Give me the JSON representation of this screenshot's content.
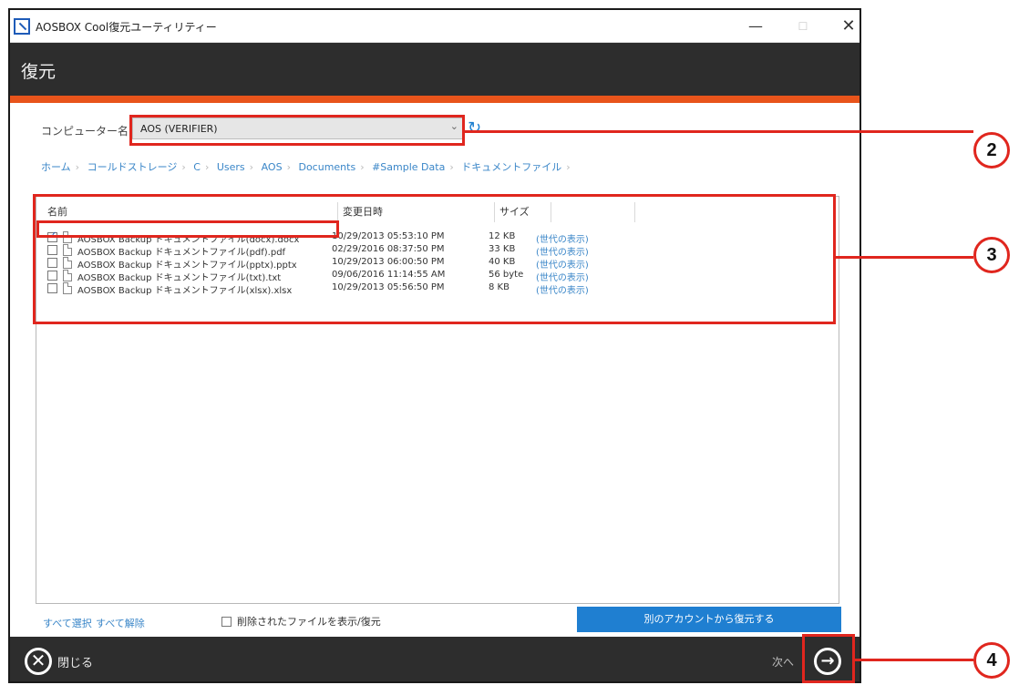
{
  "window": {
    "title": "AOSBOX Cool復元ユーティリティー",
    "minimize": "—",
    "maximize": "☐",
    "close": "✕"
  },
  "header": {
    "title": "復元"
  },
  "computer": {
    "label": "コンピューター名",
    "value": "AOS (VERIFIER)"
  },
  "breadcrumb": [
    "ホーム",
    "コールドストレージ",
    "C",
    "Users",
    "AOS",
    "Documents",
    "#Sample Data",
    "ドキュメントファイル"
  ],
  "breadcrumb_sep": "›",
  "table": {
    "columns": {
      "name": "名前",
      "date": "変更日時",
      "size": "サイズ"
    },
    "rows": [
      {
        "name": "AOSBOX Backup ドキュメントファイル(docx).docx",
        "date": "10/29/2013 05:53:10 PM",
        "size": "12 KB",
        "link": "(世代の表示)",
        "checked": true
      },
      {
        "name": "AOSBOX Backup ドキュメントファイル(pdf).pdf",
        "date": "02/29/2016 08:37:50 PM",
        "size": "33 KB",
        "link": "(世代の表示)",
        "checked": false
      },
      {
        "name": "AOSBOX Backup ドキュメントファイル(pptx).pptx",
        "date": "10/29/2013 06:00:50 PM",
        "size": "40 KB",
        "link": "(世代の表示)",
        "checked": false
      },
      {
        "name": "AOSBOX Backup ドキュメントファイル(txt).txt",
        "date": "09/06/2016 11:14:55 AM",
        "size": "56 byte",
        "link": "(世代の表示)",
        "checked": false
      },
      {
        "name": "AOSBOX Backup ドキュメントファイル(xlsx).xlsx",
        "date": "10/29/2013 05:56:50 PM",
        "size": "8 KB",
        "link": "(世代の表示)",
        "checked": false
      }
    ]
  },
  "bottom": {
    "select_all": "すべて選択",
    "deselect_all": "すべて解除",
    "show_deleted": "削除されたファイルを表示/復元",
    "other_account": "別のアカウントから復元する"
  },
  "footer": {
    "close_label": "閉じる",
    "next_label": "次へ"
  },
  "callouts": {
    "c2": "2",
    "c3": "3",
    "c4": "4"
  },
  "colors": {
    "accent": "#e8541b",
    "header_bg": "#2d2d2d",
    "link": "#3a86c8",
    "button": "#1f7fd1",
    "highlight": "#e0261e"
  }
}
